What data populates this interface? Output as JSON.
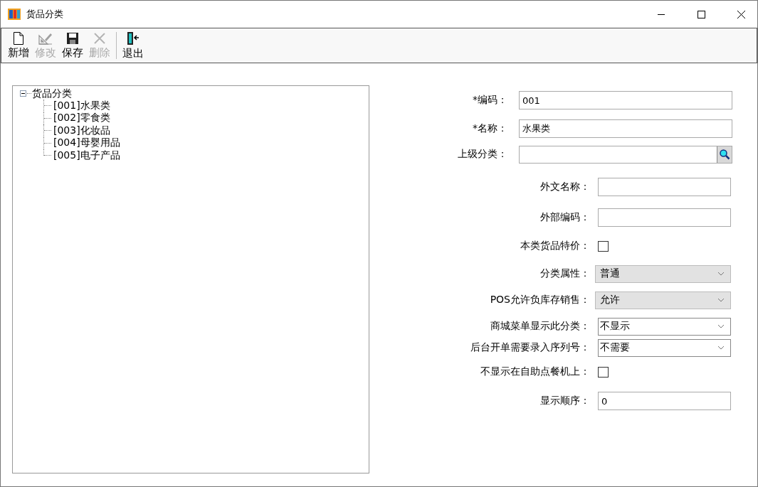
{
  "window": {
    "title": "货品分类"
  },
  "toolbar": [
    {
      "label": "新增",
      "kind": "new",
      "disabled": false
    },
    {
      "label": "修改",
      "kind": "edit",
      "disabled": true
    },
    {
      "label": "保存",
      "kind": "save",
      "disabled": false
    },
    {
      "label": "删除",
      "kind": "delete",
      "disabled": true
    },
    {
      "label": "退出",
      "kind": "exit",
      "disabled": false
    }
  ],
  "tree": {
    "label": "货品分类",
    "expanded": true,
    "children": [
      {
        "label": "[001]水果类"
      },
      {
        "label": "[002]零食类"
      },
      {
        "label": "[003]化妆品"
      },
      {
        "label": "[004]母婴用品"
      },
      {
        "label": "[005]电子产品"
      }
    ]
  },
  "main_fields": [
    {
      "label": "*编码：",
      "kind": "text",
      "value": "001"
    },
    {
      "label": "*名称：",
      "kind": "text",
      "value": "水果类"
    },
    {
      "label": "上级分类：",
      "kind": "search"
    }
  ],
  "extra_fields": [
    {
      "label": "外文名称：",
      "kind": "text"
    },
    {
      "label": "外部编码：",
      "kind": "text"
    },
    {
      "label": "本类货品特价：",
      "kind": "checkbox",
      "checked": false
    },
    {
      "label": "分类属性：",
      "kind": "select",
      "editable": false,
      "value": "普通"
    },
    {
      "label": "POS允许负库存销售：",
      "kind": "select",
      "editable": false,
      "value": "允许"
    },
    {
      "label": "商城菜单显示此分类：",
      "kind": "select",
      "editable": true,
      "value": "不显示"
    },
    {
      "label": "后台开单需要录入序列号：",
      "kind": "select",
      "editable": true,
      "value": "不需要"
    },
    {
      "label": "不显示在自助点餐机上：",
      "kind": "checkbox",
      "checked": false
    },
    {
      "label": "显示顺序：",
      "kind": "text",
      "value": "0"
    }
  ]
}
